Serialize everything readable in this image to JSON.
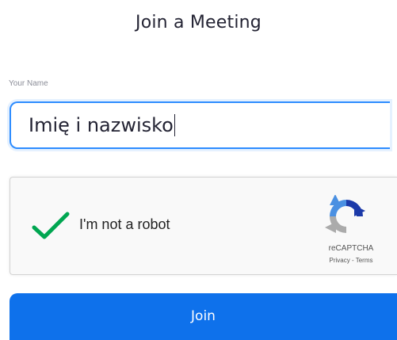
{
  "header": {
    "title": "Join a Meeting"
  },
  "form": {
    "name_label": "Your Name",
    "name_value": "Imię i nazwisko"
  },
  "captcha": {
    "label": "I'm not a robot",
    "checked": true,
    "brand": "reCAPTCHA",
    "privacy_link": "Privacy",
    "separator": " - ",
    "terms_link": "Terms",
    "check_color": "#00a651",
    "logo_icon": "recaptcha-logo-icon"
  },
  "actions": {
    "join_label": "Join",
    "join_color": "#0e71eb"
  },
  "colors": {
    "input_focus_border": "#2d8cff",
    "text_primary": "#232333"
  }
}
